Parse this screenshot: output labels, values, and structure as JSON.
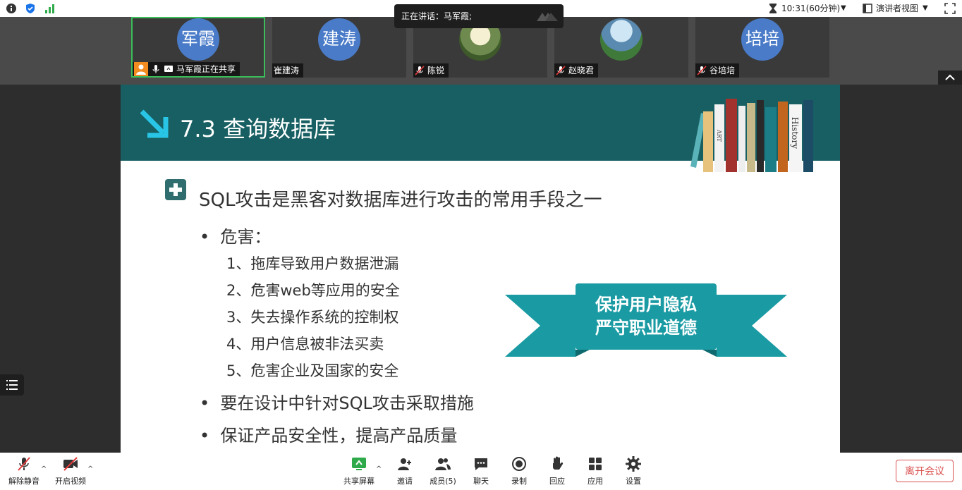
{
  "top_bar": {
    "speaking_text": "正在讲话：马军霞;",
    "time_label": "10:31(60分钟)",
    "view_label": "演讲者视图"
  },
  "participants": [
    {
      "avatar_text": "军霞",
      "name": "马军霞正在共享",
      "photo": false
    },
    {
      "avatar_text": "建涛",
      "name": "崔建涛",
      "photo": false
    },
    {
      "avatar_text": "",
      "name": "陈锐",
      "photo": true
    },
    {
      "avatar_text": "",
      "name": "赵晓君",
      "photo": true
    },
    {
      "avatar_text": "培培",
      "name": "谷培培",
      "photo": false
    }
  ],
  "slide": {
    "title": "7.3 查询数据库",
    "heading": "SQL攻击是黑客对数据库进行攻击的常用手段之一",
    "bullet1": "危害：",
    "subitems": [
      "1、拖库导致用户数据泄漏",
      "2、危害web等应用的安全",
      "3、失去操作系统的控制权",
      "4、用户信息被非法买卖",
      "5、危害企业及国家的安全"
    ],
    "bullet2": "要在设计中针对SQL攻击采取措施",
    "bullet3": "保证产品安全性，提高产品质量",
    "ribbon_line1": "保护用户隐私",
    "ribbon_line2": "严守职业道德",
    "book_labels": [
      "ART",
      "History"
    ]
  },
  "bottom_bar": {
    "unmute": "解除静音",
    "start_video": "开启视频",
    "share_screen": "共享屏幕",
    "invite": "邀请",
    "members": "成员(5)",
    "chat": "聊天",
    "record": "录制",
    "react": "回应",
    "apps": "应用",
    "settings": "设置",
    "leave": "离开会议"
  },
  "colors": {
    "teal_header": "#175f62",
    "ribbon": "#1a9ba3",
    "active_border": "#3cbd5a",
    "leave": "#d9534f"
  }
}
